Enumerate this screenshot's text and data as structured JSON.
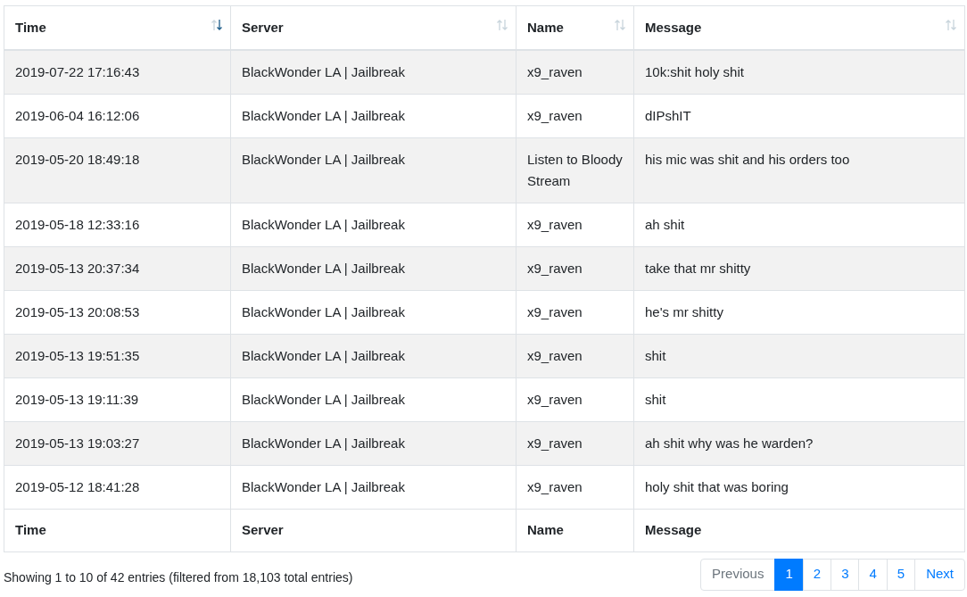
{
  "table": {
    "columns": [
      {
        "label": "Time",
        "sorted": true
      },
      {
        "label": "Server",
        "sorted": false
      },
      {
        "label": "Name",
        "sorted": false
      },
      {
        "label": "Message",
        "sorted": false
      }
    ],
    "rows": [
      [
        "2019-07-22 17:16:43",
        "BlackWonder LA | Jailbreak",
        "x9_raven",
        "10k:shit holy shit"
      ],
      [
        "2019-06-04 16:12:06",
        "BlackWonder LA | Jailbreak",
        "x9_raven",
        "dIPshIT"
      ],
      [
        "2019-05-20 18:49:18",
        "BlackWonder LA | Jailbreak",
        "Listen to Bloody Stream",
        "his mic was shit and his orders too"
      ],
      [
        "2019-05-18 12:33:16",
        "BlackWonder LA | Jailbreak",
        "x9_raven",
        "ah shit"
      ],
      [
        "2019-05-13 20:37:34",
        "BlackWonder LA | Jailbreak",
        "x9_raven",
        "take that mr shitty"
      ],
      [
        "2019-05-13 20:08:53",
        "BlackWonder LA | Jailbreak",
        "x9_raven",
        "he's mr shitty"
      ],
      [
        "2019-05-13 19:51:35",
        "BlackWonder LA | Jailbreak",
        "x9_raven",
        "shit"
      ],
      [
        "2019-05-13 19:11:39",
        "BlackWonder LA | Jailbreak",
        "x9_raven",
        "shit"
      ],
      [
        "2019-05-13 19:03:27",
        "BlackWonder LA | Jailbreak",
        "x9_raven",
        "ah shit why was he warden?"
      ],
      [
        "2019-05-12 18:41:28",
        "BlackWonder LA | Jailbreak",
        "x9_raven",
        "holy shit that was boring"
      ]
    ],
    "footer": [
      "Time",
      "Server",
      "Name",
      "Message"
    ]
  },
  "info": "Showing 1 to 10 of 42 entries (filtered from 18,103 total entries)",
  "pagination": [
    {
      "label": "Previous",
      "kind": "nav",
      "disabled": true,
      "selected": false
    },
    {
      "label": "1",
      "kind": "page",
      "disabled": false,
      "selected": true
    },
    {
      "label": "2",
      "kind": "page",
      "disabled": false,
      "selected": false
    },
    {
      "label": "3",
      "kind": "page",
      "disabled": false,
      "selected": false
    },
    {
      "label": "4",
      "kind": "page",
      "disabled": false,
      "selected": false
    },
    {
      "label": "5",
      "kind": "page",
      "disabled": false,
      "selected": false
    },
    {
      "label": "Next",
      "kind": "nav",
      "disabled": false,
      "selected": false
    }
  ]
}
